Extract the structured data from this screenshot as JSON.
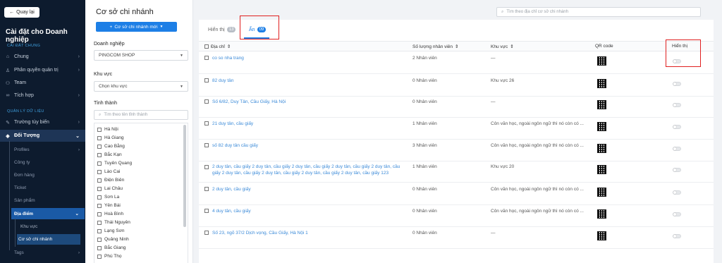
{
  "sidebar": {
    "back_label": "Quay lại",
    "title": "Cài đặt cho Doanh nghiệp",
    "section_general": "CÀI ĐẶT CHUNG",
    "section_data": "QUẢN LÝ DỮ LIỆU",
    "items": [
      {
        "label": "Chung",
        "icon": "home-icon"
      },
      {
        "label": "Phân quyền quản trị",
        "icon": "user-icon"
      },
      {
        "label": "Team",
        "icon": "team-icon"
      },
      {
        "label": "Tích hợp",
        "icon": "link-icon"
      }
    ],
    "data_items": [
      {
        "label": "Trường tùy biến",
        "icon": "edit-icon"
      },
      {
        "label": "Đối Tượng",
        "icon": "cube-icon"
      }
    ],
    "sub_items": [
      "Profiles",
      "Công ty",
      "Đơn hàng",
      "Ticket",
      "Sản phẩm",
      "Địa điểm"
    ],
    "sub2_items": [
      "Khu vực",
      "Cơ sở chi nhánh"
    ],
    "tags_label": "Tags"
  },
  "filter": {
    "title": "Cơ sở chi nhánh",
    "add_button": "Cơ sở chi nhánh mới",
    "business_label": "Doanh nghiệp",
    "business_value": "PINGCOM SHOP",
    "region_label": "Khu vực",
    "region_placeholder": "Chọn khu vực",
    "province_label": "Tỉnh thành",
    "province_search_placeholder": "Tìm theo tên tỉnh thành",
    "provinces": [
      "Hà Nội",
      "Hà Giang",
      "Cao Bằng",
      "Bắc Kạn",
      "Tuyên Quang",
      "Lào Cai",
      "Điện Biên",
      "Lai Châu",
      "Sơn La",
      "Yên Bái",
      "Hoà Bình",
      "Thái Nguyên",
      "Lạng Sơn",
      "Quảng Ninh",
      "Bắc Giang",
      "Phú Thọ"
    ]
  },
  "main": {
    "search_placeholder": "Tìm theo địa chỉ cơ sở chi nhánh",
    "tabs": [
      {
        "label": "Hiển thị",
        "count": "13"
      },
      {
        "label": "Ẩn",
        "count": "09"
      }
    ],
    "columns": {
      "address": "Địa chỉ",
      "staff": "Số lượng nhân viên",
      "region": "Khu vực",
      "qr": "QR code",
      "visible": "Hiển thị"
    },
    "rows": [
      {
        "address": "co so nha trang",
        "staff": "2 Nhân viên",
        "region": "—"
      },
      {
        "address": "82 duy tân",
        "staff": "0 Nhân viên",
        "region": "Khu vực 26"
      },
      {
        "address": "Số 6/82, Duy Tân, Cầu Giấy, Hà Nội",
        "staff": "0 Nhân viên",
        "region": "—"
      },
      {
        "address": "21 duy tân, cầu giấy",
        "staff": "1 Nhân viên",
        "region": "Côn văn học, ngoài ngôn ngữ thì nó còn có ..."
      },
      {
        "address": "số 82 duy tân cầu giấy",
        "staff": "3 Nhân viên",
        "region": "Côn văn học, ngoài ngôn ngữ thì nó còn có ..."
      },
      {
        "address": "2 duy tân, cầu giấy 2 duy tân, cầu giấy 2 duy tân, cầu giấy 2 duy tân, cầu giấy 2 duy tân, cầu giấy 2 duy tân, cầu giấy 2 duy tân, cầu giấy 2 duy tân, cầu giấy 2 duy tân, cầu giấy 123",
        "staff": "1 Nhân viên",
        "region": "Khu vực 20"
      },
      {
        "address": "2 duy tân, cầu giấy",
        "staff": "0 Nhân viên",
        "region": "Côn văn học, ngoài ngôn ngữ thì nó còn có ..."
      },
      {
        "address": "4 duy tân, cầu giấy",
        "staff": "0 Nhân viên",
        "region": "Côn văn học, ngoài ngôn ngữ thì nó còn có ..."
      },
      {
        "address": "Số 23, ngõ 37/2 Dịch vọng, Cầu Giấy, Hà Nội 1",
        "staff": "0 Nhân viên",
        "region": "—"
      }
    ]
  },
  "colors": {
    "accent": "#1d7fe6",
    "sidebar_bg": "#0d1b2e",
    "highlight": "#e02020"
  }
}
